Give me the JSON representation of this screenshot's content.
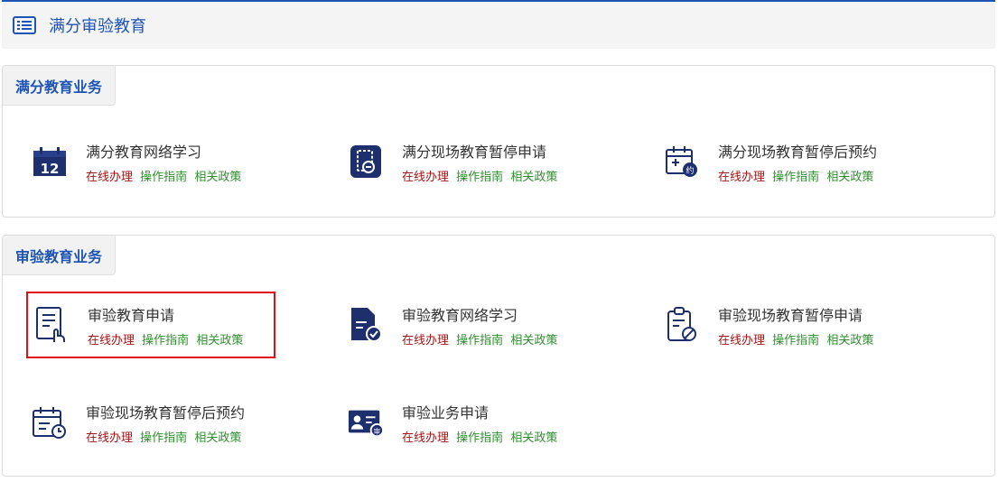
{
  "header": {
    "title": "满分审验教育",
    "icon": "list-icon"
  },
  "colors": {
    "primary": "#1e55b4",
    "online": "#a31515",
    "green": "#2f8f2f",
    "highlight": "#e01010"
  },
  "sections": [
    {
      "tab": "满分教育业务",
      "items": [
        {
          "title": "满分教育网络学习",
          "icon": "calendar-12-icon"
        },
        {
          "title": "满分现场教育暂停申请",
          "icon": "pause-clock-icon"
        },
        {
          "title": "满分现场教育暂停后预约",
          "icon": "calendar-appointment-icon"
        }
      ]
    },
    {
      "tab": "审验教育业务",
      "items": [
        {
          "title": "审验教育申请",
          "icon": "document-hand-icon"
        },
        {
          "title": "审验教育网络学习",
          "icon": "document-check-icon"
        },
        {
          "title": "审验现场教育暂停申请",
          "icon": "clipboard-stop-icon"
        },
        {
          "title": "审验现场教育暂停后预约",
          "icon": "calendar-clock-icon"
        },
        {
          "title": "审验业务申请",
          "icon": "id-card-icon"
        }
      ]
    }
  ],
  "links": {
    "online": "在线办理",
    "guide": "操作指南",
    "policy": "相关政策"
  }
}
